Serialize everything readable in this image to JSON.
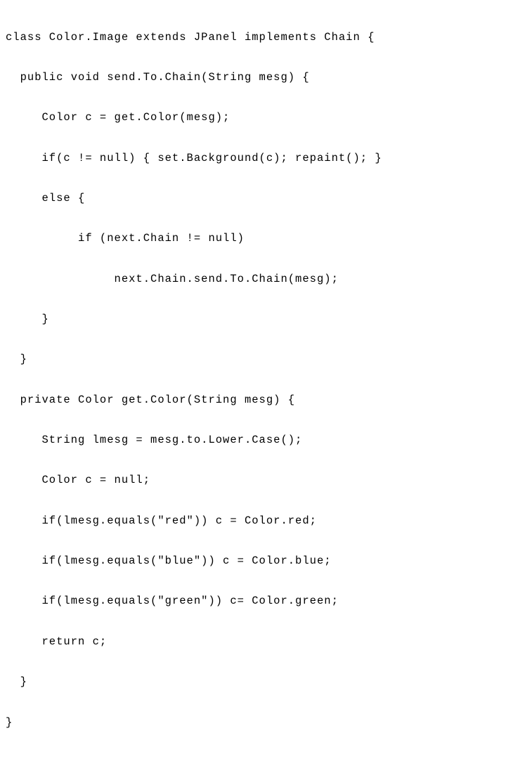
{
  "code": {
    "lines": [
      "class Color.Image extends JPanel implements Chain {",
      "  public void send.To.Chain(String mesg) {",
      "     Color c = get.Color(mesg);",
      "     if(c != null) { set.Background(c); repaint(); }",
      "     else {",
      "          if (next.Chain != null)",
      "               next.Chain.send.To.Chain(mesg);",
      "     }",
      "  }",
      "  private Color get.Color(String mesg) {",
      "     String lmesg = mesg.to.Lower.Case();",
      "     Color c = null;",
      "     if(lmesg.equals(\"red\")) c = Color.red;",
      "     if(lmesg.equals(\"blue\")) c = Color.blue;",
      "     if(lmesg.equals(\"green\")) c= Color.green;",
      "     return c;",
      "  }",
      "}"
    ]
  }
}
